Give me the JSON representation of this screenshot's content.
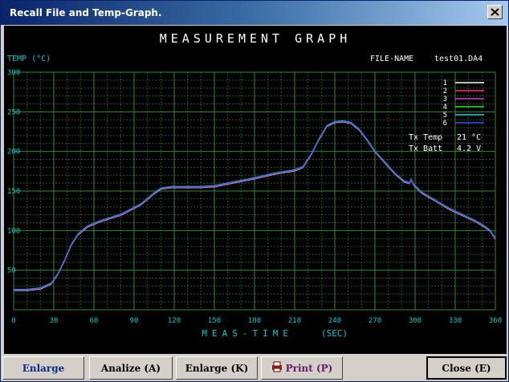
{
  "window": {
    "title": "Recall File and Temp-Graph."
  },
  "graph": {
    "heading": "MEASUREMENT  GRAPH",
    "file_name_label": "FILE-NAME",
    "file_name": "test01.DA4",
    "tx_temp_label": "Tx Temp",
    "tx_temp_value": "21 °C",
    "tx_batt_label": "Tx Batt",
    "tx_batt_value": "4.2  V",
    "colors": {
      "axis_text": "#00cccc",
      "grid": "#2e8b2e",
      "grid_dash": "#1f5f1f",
      "series": [
        "#ffffff",
        "#ff3060",
        "#d040d0",
        "#30e030",
        "#20d0e0",
        "#3050ff"
      ]
    }
  },
  "chart_data": {
    "type": "line",
    "xlabel": "MEAS-TIME",
    "xunit": "(SEC)",
    "ylabel": "TEMP (°C)",
    "xlim": [
      0,
      360
    ],
    "ylim": [
      0,
      300
    ],
    "x_ticks": [
      0,
      30,
      60,
      90,
      120,
      150,
      180,
      210,
      240,
      270,
      300,
      330,
      360
    ],
    "y_ticks": [
      50,
      100,
      150,
      200,
      250,
      300
    ],
    "grid": true,
    "legend_position": "top-right",
    "series": [
      {
        "name": "1",
        "color": "#ffffff"
      },
      {
        "name": "2",
        "color": "#ff3060"
      },
      {
        "name": "3",
        "color": "#d040d0"
      },
      {
        "name": "4",
        "color": "#30e030"
      },
      {
        "name": "5",
        "color": "#20d0e0"
      },
      {
        "name": "6",
        "color": "#3050ff"
      }
    ],
    "points": [
      [
        0,
        25
      ],
      [
        10,
        25
      ],
      [
        20,
        27
      ],
      [
        28,
        33
      ],
      [
        33,
        45
      ],
      [
        38,
        62
      ],
      [
        43,
        82
      ],
      [
        48,
        95
      ],
      [
        55,
        105
      ],
      [
        65,
        112
      ],
      [
        80,
        120
      ],
      [
        95,
        133
      ],
      [
        105,
        147
      ],
      [
        110,
        153
      ],
      [
        118,
        155
      ],
      [
        130,
        155
      ],
      [
        140,
        155
      ],
      [
        150,
        156
      ],
      [
        165,
        161
      ],
      [
        180,
        166
      ],
      [
        195,
        172
      ],
      [
        210,
        176
      ],
      [
        216,
        180
      ],
      [
        222,
        195
      ],
      [
        228,
        215
      ],
      [
        234,
        232
      ],
      [
        240,
        237
      ],
      [
        246,
        238
      ],
      [
        252,
        236
      ],
      [
        258,
        228
      ],
      [
        264,
        215
      ],
      [
        270,
        200
      ],
      [
        278,
        185
      ],
      [
        285,
        172
      ],
      [
        292,
        162
      ],
      [
        296,
        160
      ],
      [
        297,
        165
      ],
      [
        299,
        158
      ],
      [
        305,
        148
      ],
      [
        315,
        138
      ],
      [
        325,
        128
      ],
      [
        335,
        120
      ],
      [
        345,
        112
      ],
      [
        352,
        105
      ],
      [
        356,
        100
      ],
      [
        360,
        90
      ]
    ]
  },
  "buttons": {
    "enlarge_first": "Enlarge",
    "analize": "Analize (A)",
    "enlarge_k": "Enlarge (K)",
    "print": "Print (P)",
    "close": "Close (E)"
  }
}
